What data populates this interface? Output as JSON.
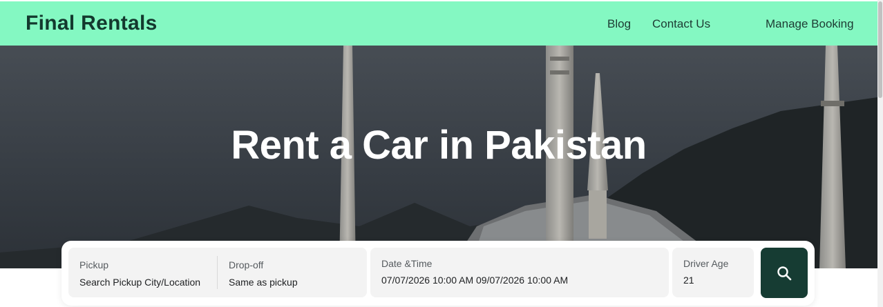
{
  "header": {
    "logo": "Final Rentals",
    "nav": {
      "blog": "Blog",
      "contact": "Contact Us",
      "manage_booking": "Manage Booking"
    }
  },
  "hero": {
    "title": "Rent a Car in Pakistan"
  },
  "search": {
    "pickup": {
      "label": "Pickup",
      "value": "Search Pickup City/Location"
    },
    "dropoff": {
      "label": "Drop-off",
      "value": "Same as pickup"
    },
    "datetime": {
      "label": "Date &Time",
      "value": "07/07/2026 10:00 AM 09/07/2026 10:00 AM"
    },
    "driver_age": {
      "label": "Driver Age",
      "value": "21"
    },
    "button_icon": "search-icon"
  },
  "colors": {
    "header_bg": "#84f8c2",
    "brand_dark": "#163c33",
    "field_bg": "#f3f3f3"
  }
}
